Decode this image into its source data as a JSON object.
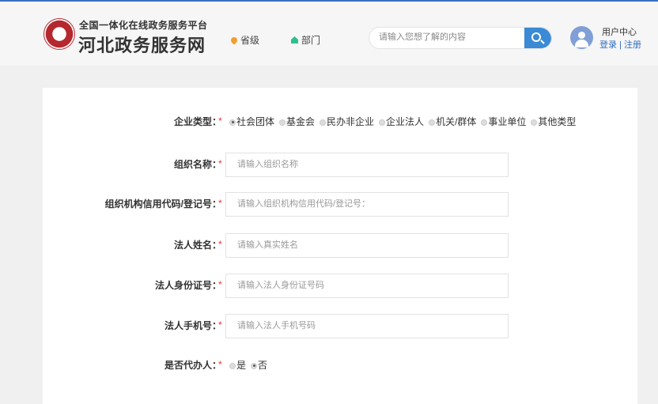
{
  "header": {
    "subtitle": "全国一体化在线政务服务平台",
    "title": "河北政务服务网",
    "nav": [
      {
        "label": "省级",
        "icon": "location-pin-icon"
      },
      {
        "label": "部门",
        "icon": "home-icon"
      }
    ],
    "search_placeholder": "请输入您想了解的内容",
    "user_center": "用户中心",
    "login": "登录",
    "separator": "|",
    "register": "注册"
  },
  "colors": {
    "accent": "#3a8ad6",
    "required": "#e33333",
    "link": "#2d6bc4"
  },
  "form": {
    "required_mark": "*",
    "enterprise_type": {
      "label": "企业类型：",
      "options": [
        "社会团体",
        "基金会",
        "民办非企业",
        "企业法人",
        "机关/群体",
        "事业单位",
        "其他类型"
      ],
      "selected": "社会团体"
    },
    "fields": [
      {
        "label": "组织名称：",
        "placeholder": "请输入组织名称"
      },
      {
        "label": "组织机构信用代码/登记号：",
        "placeholder": "请输入组织机构信用代码/登记号："
      },
      {
        "label": "法人姓名：",
        "placeholder": "请输入真实姓名"
      },
      {
        "label": "法人身份证号：",
        "placeholder": "请输入法人身份证号码"
      },
      {
        "label": "法人手机号：",
        "placeholder": "请输入法人手机号码"
      }
    ],
    "agent": {
      "label": "是否代办人：",
      "options": [
        "是",
        "否"
      ],
      "selected": "否"
    }
  }
}
